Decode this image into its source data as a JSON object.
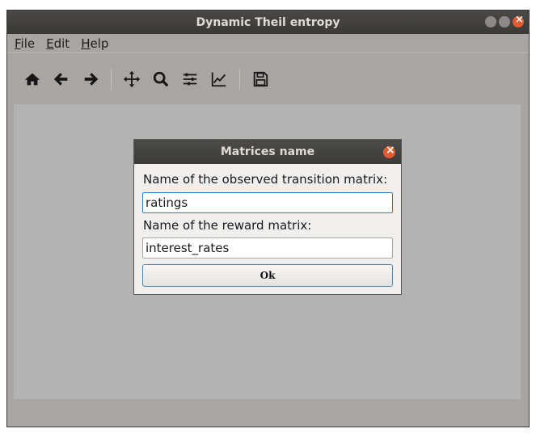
{
  "window": {
    "title": "Dynamic Theil entropy"
  },
  "menu": {
    "items": [
      {
        "mnemonic": "F",
        "rest": "ile"
      },
      {
        "mnemonic": "E",
        "rest": "dit"
      },
      {
        "mnemonic": "H",
        "rest": "elp"
      }
    ]
  },
  "toolbar": {
    "icons": [
      "home-icon",
      "back-arrow-icon",
      "forward-arrow-icon",
      "pan-icon",
      "zoom-icon",
      "subplots-config-icon",
      "axes-edit-icon",
      "save-icon"
    ]
  },
  "dialog": {
    "title": "Matrices name",
    "label_transition": "Name of the observed transition matrix:",
    "value_transition": "ratings",
    "label_reward": "Name of the reward matrix:",
    "value_reward": "interest_rates",
    "ok_label": "Ok"
  },
  "colors": {
    "accent": "#2d7fbf",
    "close": "#e25a2f"
  }
}
